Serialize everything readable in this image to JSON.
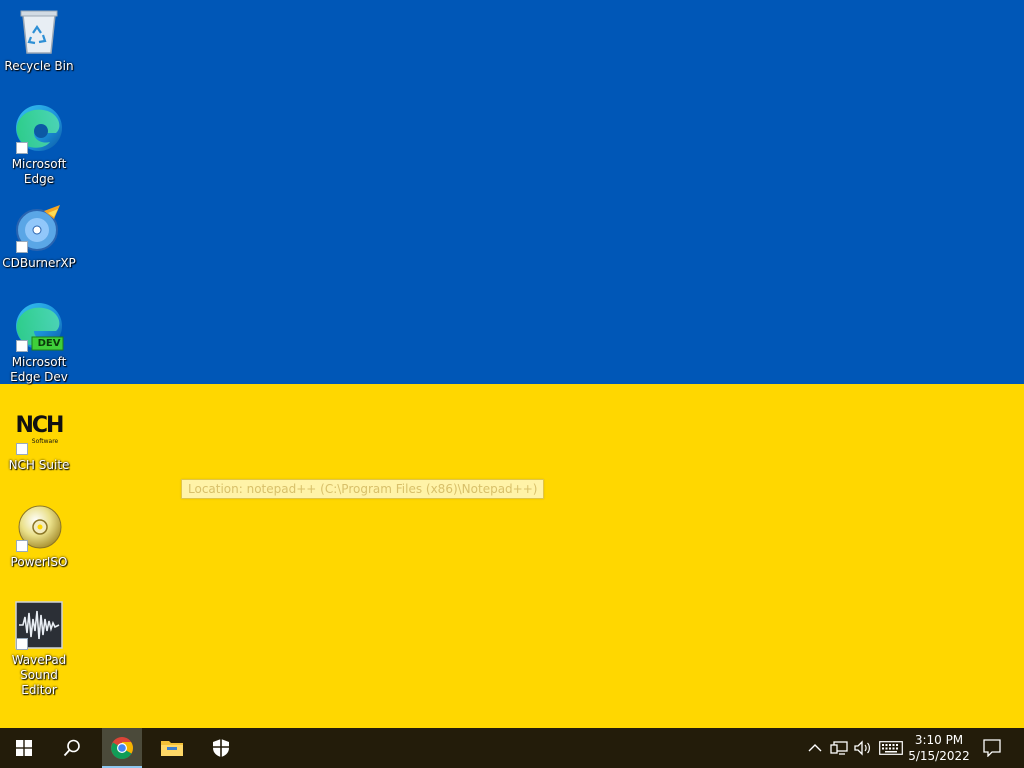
{
  "desktop": {
    "wallpaper": {
      "top_color": "#0057b7",
      "bottom_color": "#ffd700"
    },
    "icons": [
      {
        "label": "Recycle Bin",
        "icon": "recycle-bin-icon"
      },
      {
        "label": "Microsoft Edge",
        "icon": "edge-icon"
      },
      {
        "label": "CDBurnerXP",
        "icon": "cdburnerxp-icon"
      },
      {
        "label": "Microsoft Edge Dev",
        "icon": "edge-dev-icon",
        "badge": "DEV"
      },
      {
        "label": "NCH Suite",
        "icon": "nch-icon",
        "logo_text": "NCH",
        "logo_sub": "Software"
      },
      {
        "label": "PowerISO",
        "icon": "poweriso-icon"
      },
      {
        "label": "WavePad Sound Editor",
        "icon": "wavepad-icon"
      }
    ],
    "tooltip": "Location: notepad++ (C:\\Program Files (x86)\\Notepad++)"
  },
  "taskbar": {
    "buttons": [
      {
        "name": "start",
        "icon": "windows-logo-icon"
      },
      {
        "name": "search",
        "icon": "search-icon"
      },
      {
        "name": "chrome",
        "icon": "chrome-icon",
        "active": true
      },
      {
        "name": "file-explorer",
        "icon": "folder-icon"
      },
      {
        "name": "security",
        "icon": "shield-icon"
      }
    ],
    "tray": {
      "icons": [
        "chevron-up-icon",
        "network-icon",
        "volume-icon",
        "keyboard-icon"
      ],
      "time": "3:10 PM",
      "date": "5/15/2022"
    }
  }
}
